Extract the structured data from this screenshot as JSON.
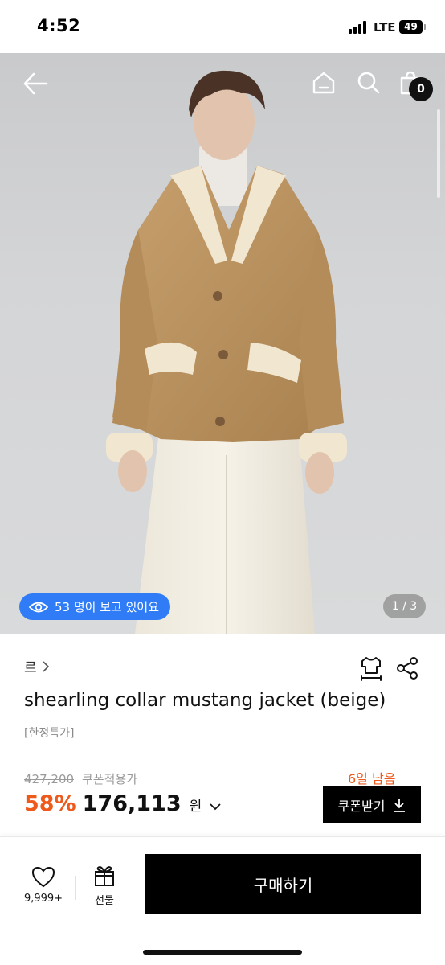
{
  "status_bar": {
    "time": "4:52",
    "network": "LTE",
    "battery": "49"
  },
  "header": {
    "icons": [
      "arrow-left-icon",
      "home-icon",
      "search-icon",
      "shopping-bag-icon"
    ],
    "cart_count": "0",
    "icon_color": "#ffffff"
  },
  "gallery": {
    "viewer_badge": "53 명이 보고 있어요",
    "viewer_badge_color": "#2f7cf6",
    "page_counter": "1 / 3"
  },
  "product": {
    "brand": "르",
    "name": "shearling collar mustang jacket (beige)",
    "tag": "[한정특가]",
    "original_price": "427,200",
    "coupon_applied_label": "쿠폰적용가",
    "days_left": "6일 남음",
    "discount": "58%",
    "sale_price": "176,113",
    "currency": "원",
    "coupon_button": "쿠폰받기",
    "accent_color": "#ee5a1c"
  },
  "bottom_bar": {
    "like_count": "9,999+",
    "gift_label": "선물",
    "buy_button": "구매하기"
  }
}
